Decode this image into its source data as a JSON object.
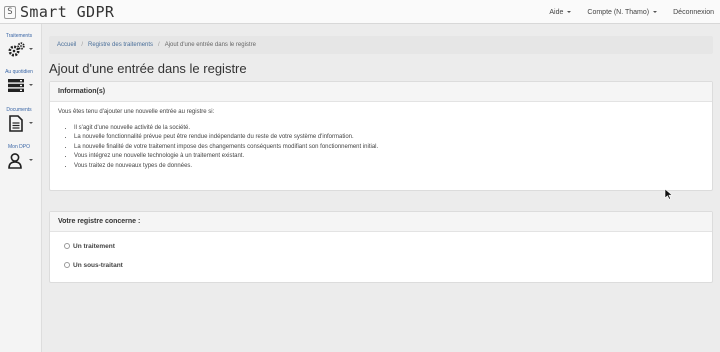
{
  "app": {
    "logo_glyph": "S",
    "name": "Smart GDPR"
  },
  "topnav": {
    "help": "Aide",
    "account": "Compte (N. Thamo)",
    "logout": "Déconnexion"
  },
  "sidebar": {
    "items": [
      {
        "label": "Traitements",
        "icon": "gears-icon"
      },
      {
        "label": "Au quotidien",
        "icon": "server-icon"
      },
      {
        "label": "Documents",
        "icon": "document-icon"
      },
      {
        "label": "Mon DPO",
        "icon": "user-icon"
      }
    ]
  },
  "breadcrumb": {
    "home": "Accueil",
    "registry": "Registre des traitements",
    "current": "Ajout d'une entrée dans le registre"
  },
  "page": {
    "title": "Ajout d'une entrée dans le registre"
  },
  "info_panel": {
    "title": "Information(s)",
    "intro": "Vous êtes tenu d'ajouter une nouvelle entrée au registre si:",
    "bullets": [
      "Il s'agit d'une nouvelle activité de la société.",
      "La nouvelle fonctionnalité prévue peut être rendue indépendante du reste de votre système d'information.",
      "La nouvelle finalité de votre traitement impose des changements conséquents modifiant son fonctionnement initial.",
      "Vous intégrez une nouvelle technologie à un traitement existant.",
      "Vous traitez de nouveaux types de données."
    ]
  },
  "concern_panel": {
    "title": "Votre registre concerne :",
    "options": [
      "Un traitement",
      "Un sous-traitant"
    ],
    "selected": null
  }
}
